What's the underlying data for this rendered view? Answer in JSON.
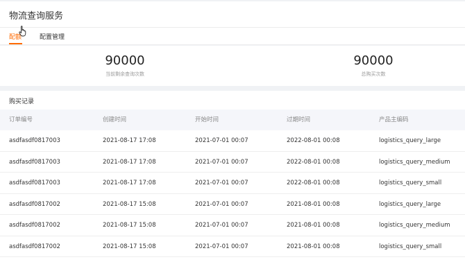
{
  "header": {
    "title": "物流查询服务"
  },
  "tabs": [
    {
      "label": "配额"
    },
    {
      "label": "配置管理"
    }
  ],
  "stats": [
    {
      "value": "90000",
      "label": "当前剩余查询次数"
    },
    {
      "value": "90000",
      "label": "总购买次数"
    }
  ],
  "records": {
    "title": "购买记录",
    "columns": [
      "订单编号",
      "创建时间",
      "开始时间",
      "过期时间",
      "产品主编码"
    ],
    "rows": [
      [
        "asdfasdf0817003",
        "2021-08-17 17:08",
        "2021-07-01 00:07",
        "2022-08-01 00:08",
        "logistics_query_large"
      ],
      [
        "asdfasdf0817003",
        "2021-08-17 17:08",
        "2021-07-01 00:07",
        "2022-08-01 00:08",
        "logistics_query_medium"
      ],
      [
        "asdfasdf0817003",
        "2021-08-17 17:08",
        "2021-07-01 00:07",
        "2022-08-01 00:08",
        "logistics_query_small"
      ],
      [
        "asdfasdf0817002",
        "2021-08-17 15:08",
        "2021-07-01 00:07",
        "2021-08-01 00:08",
        "logistics_query_large"
      ],
      [
        "asdfasdf0817002",
        "2021-08-17 15:08",
        "2021-07-01 00:07",
        "2021-08-01 00:08",
        "logistics_query_medium"
      ],
      [
        "asdfasdf0817002",
        "2021-08-17 15:08",
        "2021-07-01 00:07",
        "2021-08-01 00:08",
        "logistics_query_small"
      ]
    ]
  },
  "colors": {
    "accent": "#ff6a00",
    "header_bg": "#f5f6fa",
    "page_bg": "#f0f2f5"
  },
  "icons": {
    "cursor": "hand-pointer-icon"
  }
}
